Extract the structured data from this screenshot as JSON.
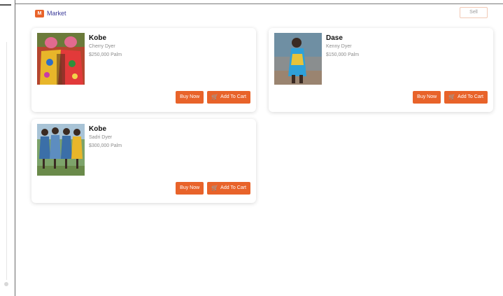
{
  "header": {
    "brand_icon": "market-icon",
    "brand_label": "Market",
    "top_right_button": "Sell"
  },
  "colors": {
    "accent": "#e8632a",
    "brand_text": "#3b3b9a"
  },
  "listings": [
    {
      "name": "Kobe",
      "detail_1": "Cherry Dyer",
      "detail_2": "$250,000 Palm",
      "buy_label": "Buy Now",
      "cart_label": "Add To Cart"
    },
    {
      "name": "Dase",
      "detail_1": "Kenny Dyer",
      "detail_2": "$150,000 Palm",
      "buy_label": "Buy Now",
      "cart_label": "Add To Cart"
    },
    {
      "name": "Kobe",
      "detail_1": "Sadri Dyer",
      "detail_2": "$300,000 Palm",
      "buy_label": "Buy Now",
      "cart_label": "Add To Cart"
    }
  ]
}
